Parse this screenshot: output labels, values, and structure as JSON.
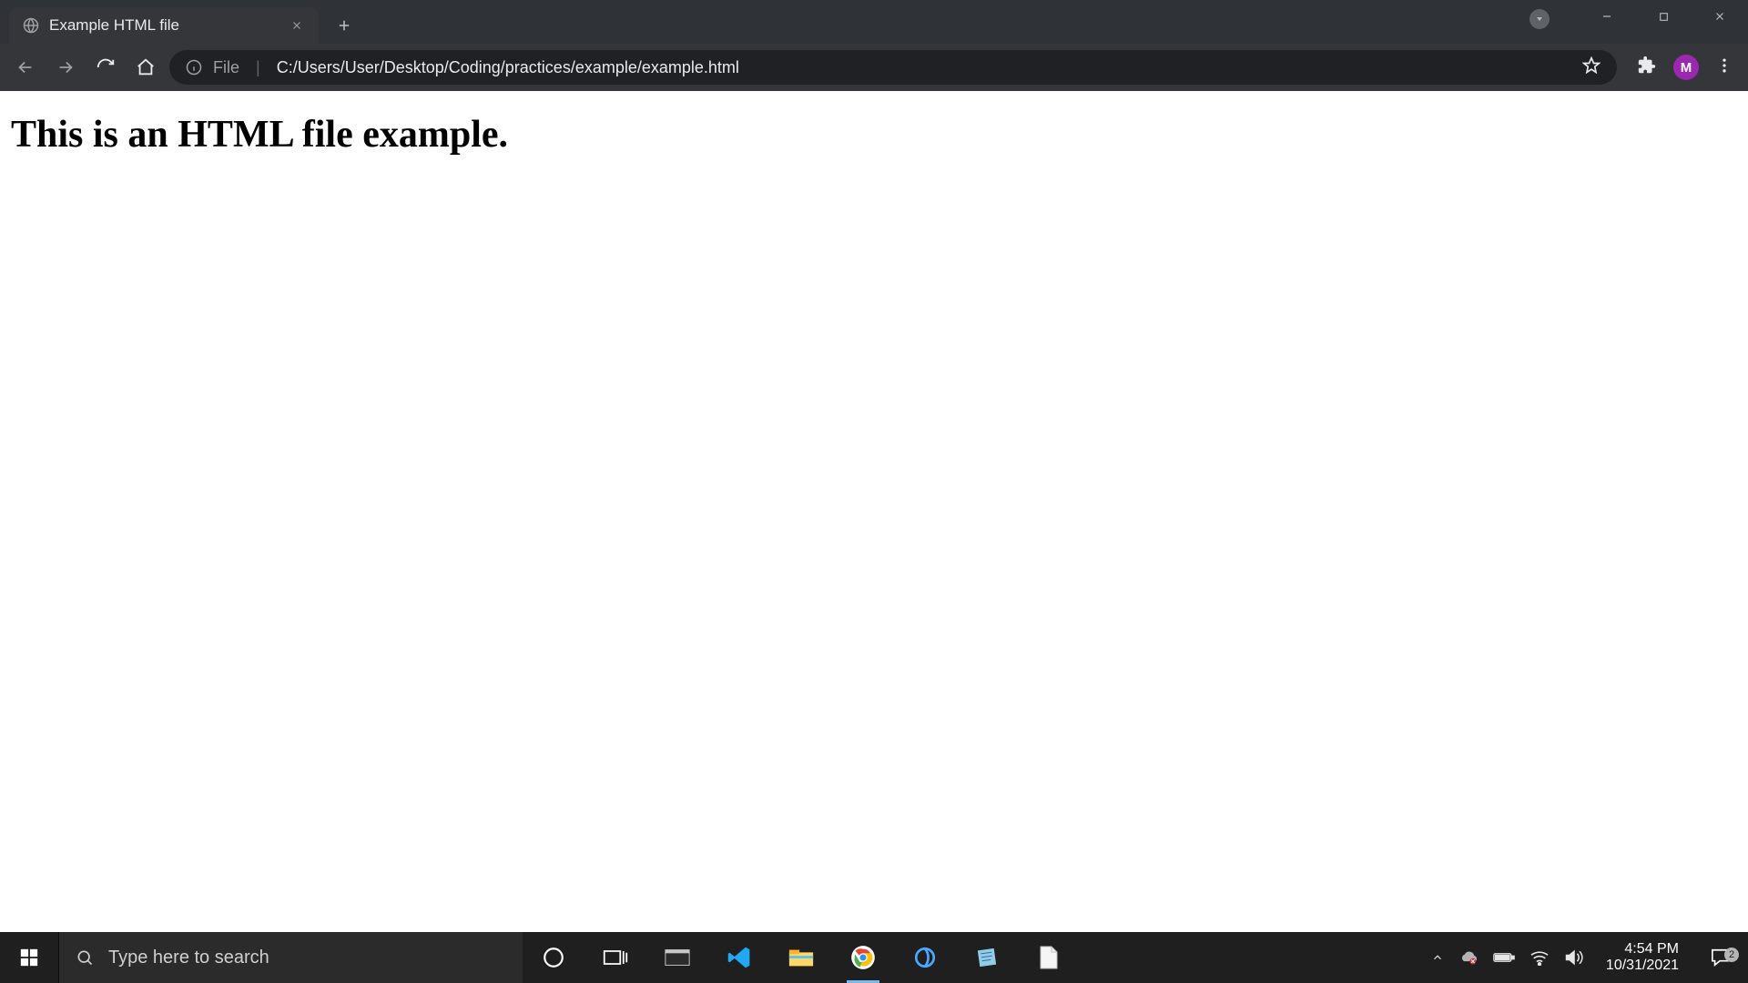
{
  "chrome": {
    "tab_title": "Example HTML file",
    "url_scheme": "File",
    "url_path": "C:/Users/User/Desktop/Coding/practices/example/example.html",
    "profile_initial": "M"
  },
  "page": {
    "heading": "This is an HTML file example."
  },
  "taskbar": {
    "search_placeholder": "Type here to search",
    "clock_time": "4:54 PM",
    "clock_date": "10/31/2021",
    "notification_count": "2"
  }
}
